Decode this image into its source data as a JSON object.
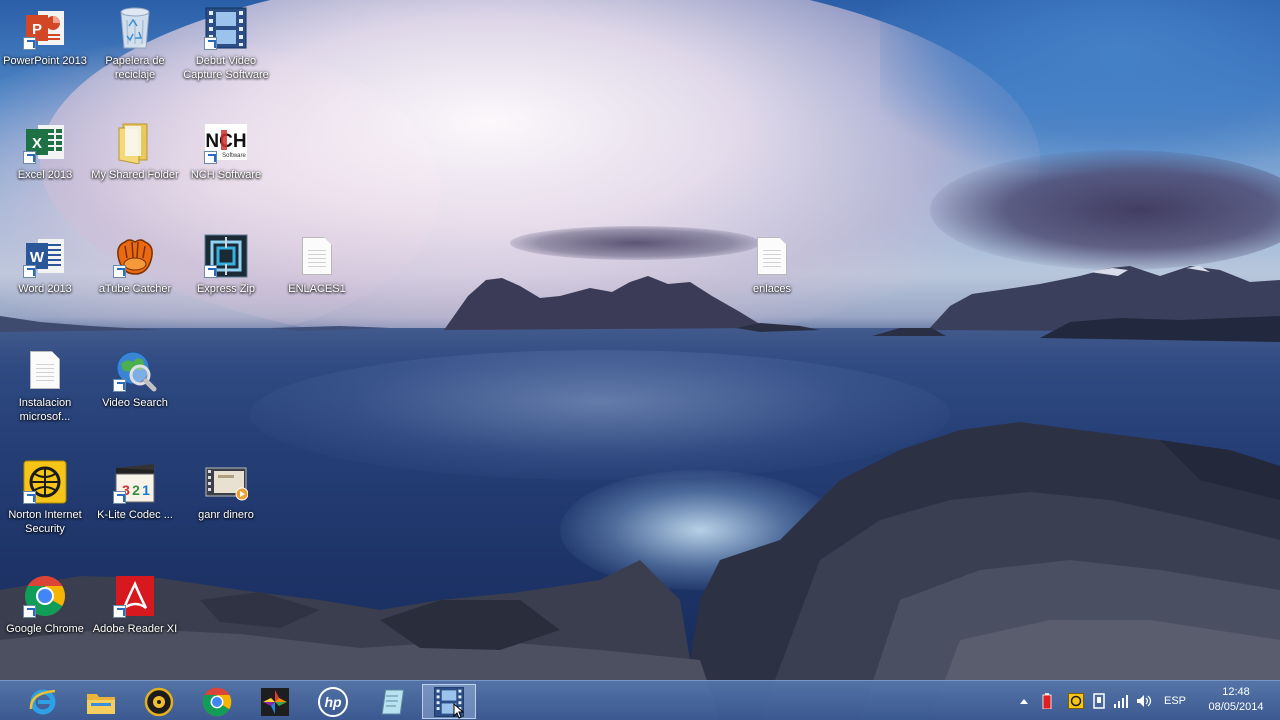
{
  "desktop": {
    "icons": [
      {
        "label": "PowerPoint 2013",
        "icon": "powerpoint-icon"
      },
      {
        "label": "Papelera de reciclaje",
        "icon": "recycle-bin-icon"
      },
      {
        "label": "Debut Video Capture Software",
        "icon": "film-strip-icon"
      },
      {
        "label": "Excel 2013",
        "icon": "excel-icon"
      },
      {
        "label": "My Shared Folder",
        "icon": "folder-icon"
      },
      {
        "label": "NCH Software",
        "icon": "nch-logo-icon"
      },
      {
        "label": "Word 2013",
        "icon": "word-icon"
      },
      {
        "label": "aTube Catcher",
        "icon": "atube-catcher-icon"
      },
      {
        "label": "Express Zip",
        "icon": "express-zip-icon"
      },
      {
        "label": "ENLACES1",
        "icon": "text-document-icon"
      },
      {
        "label": "enlaces",
        "icon": "text-document-icon"
      },
      {
        "label": "Instalacion microsof...",
        "icon": "text-document-icon"
      },
      {
        "label": "Video Search",
        "icon": "globe-search-icon"
      },
      {
        "label": "Norton Internet Security",
        "icon": "norton-icon"
      },
      {
        "label": "K-Lite Codec ...",
        "icon": "k-lite-codec-icon"
      },
      {
        "label": "ganr dinero",
        "icon": "video-file-icon"
      },
      {
        "label": "Google Chrome",
        "icon": "chrome-icon"
      },
      {
        "label": "Adobe Reader XI",
        "icon": "adobe-reader-icon"
      }
    ]
  },
  "taskbar": {
    "pinned": [
      {
        "icon": "internet-explorer-icon"
      },
      {
        "icon": "file-explorer-icon"
      },
      {
        "icon": "media-player-icon"
      },
      {
        "icon": "chrome-icon"
      },
      {
        "icon": "photo-app-icon"
      },
      {
        "icon": "hp-icon"
      },
      {
        "icon": "notepad-icon"
      },
      {
        "icon": "film-strip-icon",
        "active": true
      }
    ],
    "tray": {
      "language": "ESP",
      "time": "12:48",
      "date": "08/05/2014"
    }
  },
  "colors": {
    "taskbar": "#4a6ea8",
    "label_text": "#ffffff"
  }
}
